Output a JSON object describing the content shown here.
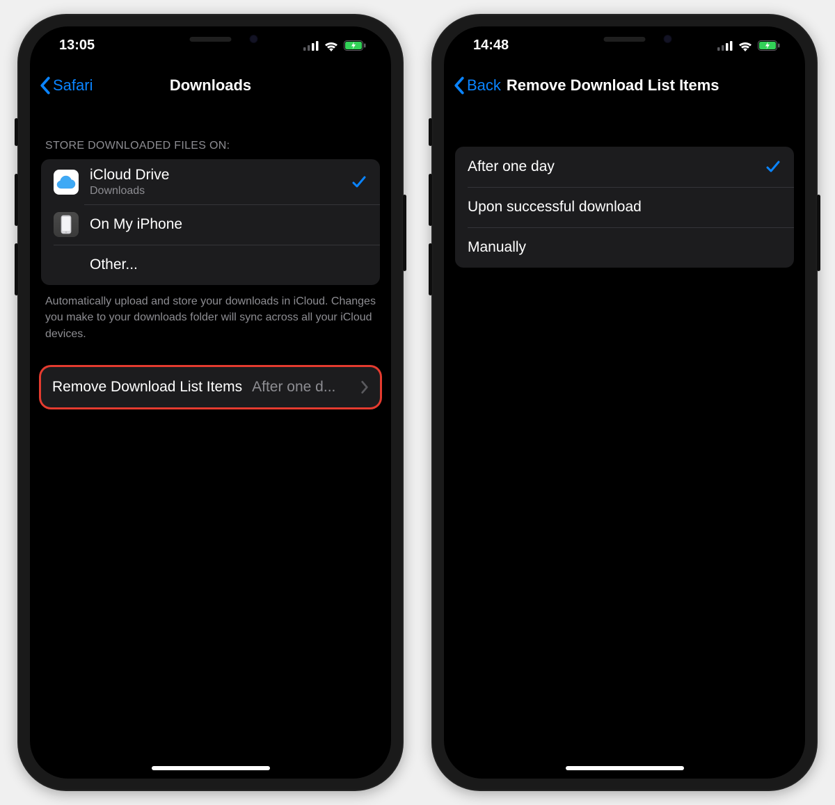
{
  "phone1": {
    "status_time": "13:05",
    "back_label": "Safari",
    "title": "Downloads",
    "section_header": "Store Downloaded Files On:",
    "storage_options": [
      {
        "title": "iCloud Drive",
        "sub": "Downloads",
        "selected": true,
        "icon": "icloud"
      },
      {
        "title": "On My iPhone",
        "sub": "",
        "selected": false,
        "icon": "iphone"
      },
      {
        "title": "Other...",
        "sub": "",
        "selected": false,
        "icon": ""
      }
    ],
    "footer": "Automatically upload and store your downloads in iCloud. Changes you make to your downloads folder will sync across all your iCloud devices.",
    "detail": {
      "label": "Remove Download List Items",
      "value": "After one d..."
    }
  },
  "phone2": {
    "status_time": "14:48",
    "back_label": "Back",
    "title": "Remove Download List Items",
    "options": [
      {
        "title": "After one day",
        "selected": true
      },
      {
        "title": "Upon successful download",
        "selected": false
      },
      {
        "title": "Manually",
        "selected": false
      }
    ]
  }
}
